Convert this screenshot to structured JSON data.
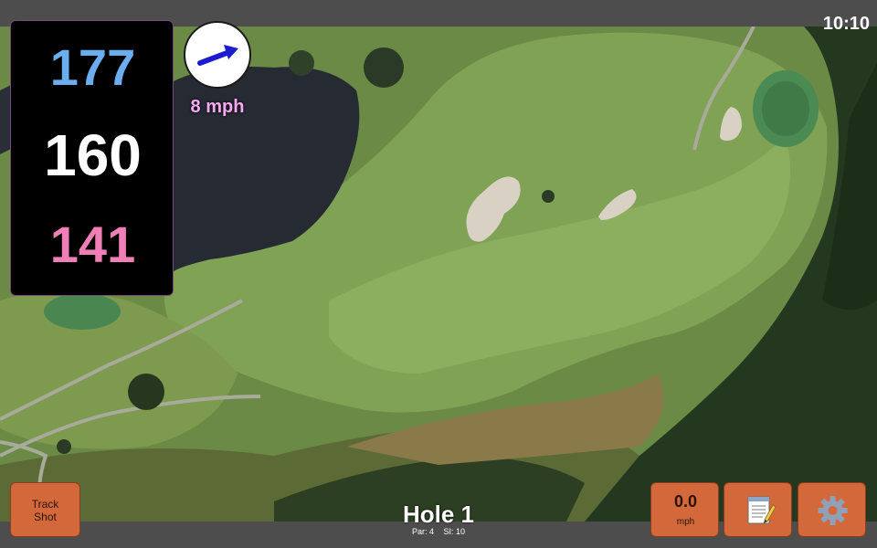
{
  "status": {
    "time": "10:10"
  },
  "distances": {
    "back": "177",
    "center": "160",
    "front": "141"
  },
  "wind": {
    "speed": "8 mph",
    "direction_icon": "wind-arrow-icon",
    "arrow_color": "#1c1ccf"
  },
  "buttons": {
    "track_shot_line1": "Track",
    "track_shot_line2": "Shot",
    "speed_value": "0.0",
    "speed_unit": "mph",
    "notes_icon": "notepad-icon",
    "settings_icon": "gear-icon"
  },
  "hole": {
    "title": "Hole 1",
    "par": "Par: 4",
    "si": "SI: 10"
  },
  "colors": {
    "accent_button": "#d3693a",
    "back_distance": "#6aaef0",
    "center_distance": "#ffffff",
    "front_distance": "#f07fb8",
    "wind_text": "#f7a8f0"
  }
}
